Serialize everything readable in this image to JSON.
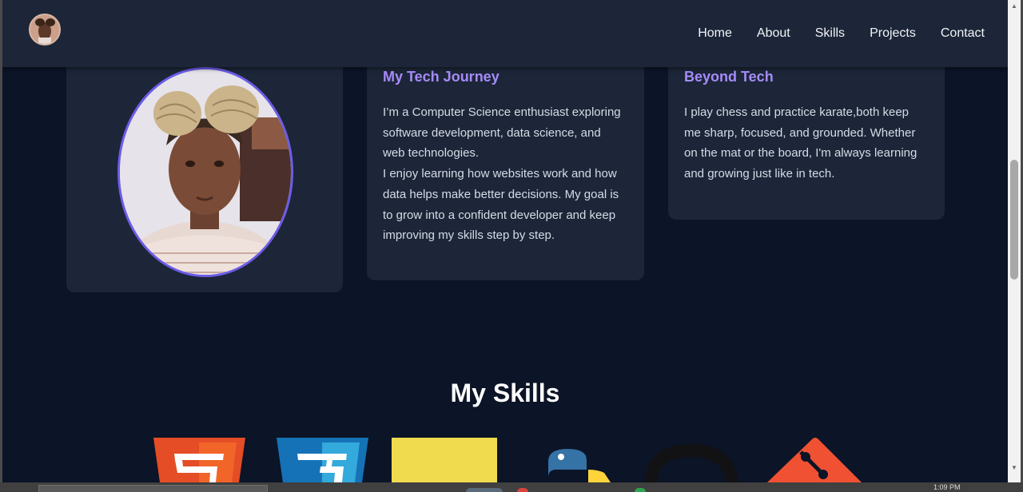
{
  "nav": {
    "links": [
      "Home",
      "About",
      "Skills",
      "Projects",
      "Contact"
    ]
  },
  "journey": {
    "title": "My Tech Journey",
    "text": "I’m a Computer Science enthusiast exploring software development, data science, and web technologies.\nI enjoy learning how websites work and how data helps make better decisions. My goal is to grow into a confident developer and keep improving my skills step by step."
  },
  "beyond": {
    "title": "Beyond Tech",
    "text": "I play chess and practice karate,both keep me sharp, focused, and grounded. Whether on the mat or the board, I'm always learning and growing just like in tech."
  },
  "skills": {
    "title": "My Skills",
    "icons": [
      "html5-icon",
      "css3-icon",
      "javascript-icon",
      "python-icon",
      "github-icon",
      "git-icon"
    ]
  },
  "taskbar": {
    "time": "1:09 PM"
  },
  "colors": {
    "background": "#0c1427",
    "card": "#1c2638",
    "accent": "#a78bfa",
    "ring": "#6c5ce7"
  }
}
